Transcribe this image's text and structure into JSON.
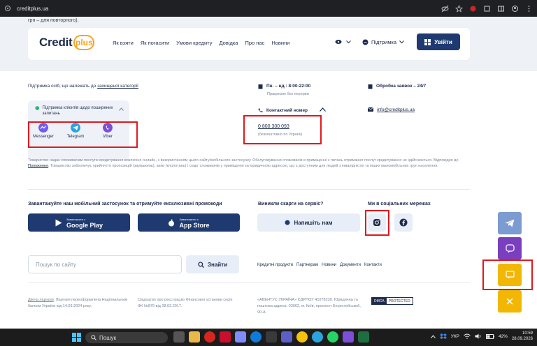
{
  "browser": {
    "url": "creditplus.ua"
  },
  "page": {
    "top_fragment": "грн – для повторного).",
    "header": {
      "logo_text": "Credit",
      "logo_plus": "plus",
      "nav": [
        "Як взяти",
        "Як погасити",
        "Умови кредиту",
        "Довідка",
        "Про нас",
        "Новини"
      ],
      "support_label": "Підтримка",
      "login_label": "Увійти"
    },
    "support_block": {
      "protected_prefix": "Підтримка осіб, що належать до",
      "protected_link": "захищеної категорії",
      "card_title": "Підтримка клієнтів щодо поширених запитань",
      "messengers": [
        "Messenger",
        "Telegram",
        "Viber"
      ]
    },
    "contacts": {
      "hours": "Пн. – нд.: 8:00-22:00",
      "hours_sub": "Працюємо без перерви",
      "processing": "Обробка заявок – 24/7",
      "phone_label": "Контактний номер",
      "email": "info@creditplus.ua",
      "phone": "0 800 300 093",
      "phone_note": "(безкоштовно по Україні)"
    },
    "legal_text": "Товариство надає споживачам послуги кредитування виключно онлайн, з використанням цього сайту/мобільного застосунку. Обслуговування споживачів в приміщенні з питань отримання послуг кредитування не здійснюється. Відповідно до",
    "legal_link": "Положення",
    "legal_text2": ", Товариство забезпечує прийняття пропозицій (зауважень), заяв (клопотань) і скарг споживачів у приміщенні за юридичною адресою, що є доступним для людей з інвалідністю та інших маломобільних груп населення.",
    "app": {
      "title": "Завантажуйте наш мобільний застосунок та отримуйте ексклюзивні промокоди",
      "google_small": "Завантажити з",
      "google": "Google Play",
      "apple_small": "Завантажити з",
      "apple": "App Store"
    },
    "complaints": {
      "title": "Виникли скарги на сервіс?",
      "button": "Напишіть нам"
    },
    "social": {
      "title": "Ми в соціальних мережах"
    },
    "search": {
      "placeholder": "Пошук по сайту",
      "button": "Знайти"
    },
    "footer_links": [
      "Кредитні продукти",
      "Партнерам",
      "Новини",
      "Документи",
      "Контакти"
    ],
    "license": {
      "link": "Діюча ліцензія",
      "text": ". Ліцензія переоформлена Національним банком України від 14.03.2024 року."
    },
    "registration": "Свідоцтво про реєстрацію Фінансової установи серія ФК №870 від 28.02.2017.",
    "company": "«АВЕНТУС УКРАЇНА» ЄДРПОУ 41078230. Юридична та поштова адреса: 03062, м. Київ, проспект Берестейський, 90-А",
    "dmca": [
      "DMCA",
      "PROTECTED"
    ]
  },
  "taskbar": {
    "search": "Пошук",
    "lang": "УКР",
    "battery": "42%",
    "time": "10:59",
    "date": "28.09.2026"
  },
  "colors": {
    "brand_navy": "#1e3a70",
    "accent_orange": "#f4a521",
    "highlight_red": "#e0191e",
    "float_telegram": "#7b9bd1",
    "float_viber": "#7a3fbf",
    "float_chat": "#f2b705"
  }
}
